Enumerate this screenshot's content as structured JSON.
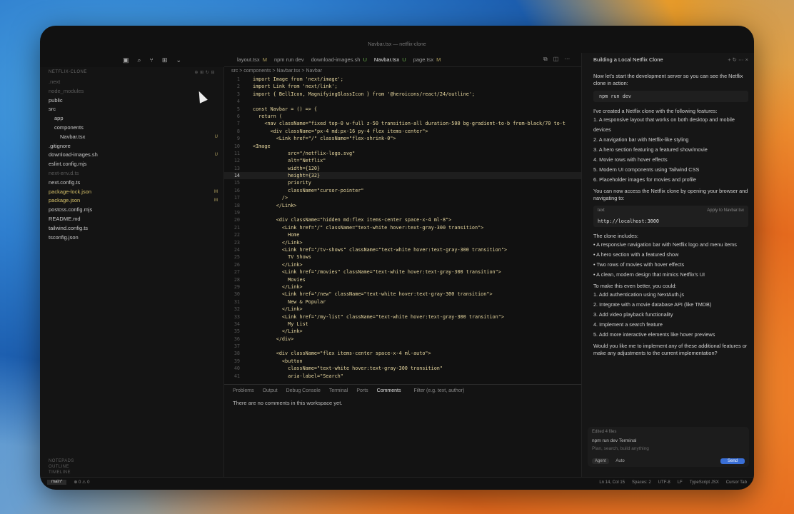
{
  "window": {
    "title": "Navbar.tsx — netflix-clone"
  },
  "explorer": {
    "header": "NETFLIX-CLONE",
    "items": [
      {
        "label": ".next",
        "style": "dim",
        "badge": ""
      },
      {
        "label": "node_modules",
        "style": "dim",
        "badge": ""
      },
      {
        "label": "public",
        "style": "",
        "badge": ""
      },
      {
        "label": "src",
        "style": "",
        "badge": ""
      },
      {
        "label": "app",
        "style": "",
        "badge": ""
      },
      {
        "label": "components",
        "style": "",
        "badge": ""
      },
      {
        "label": "Navbar.tsx",
        "style": "",
        "badge": "U"
      },
      {
        "label": ".gitignore",
        "style": "",
        "badge": ""
      },
      {
        "label": "download-images.sh",
        "style": "",
        "badge": "U"
      },
      {
        "label": "eslint.config.mjs",
        "style": "",
        "badge": ""
      },
      {
        "label": "next-env.d.ts",
        "style": "dim",
        "badge": ""
      },
      {
        "label": "next.config.ts",
        "style": "",
        "badge": ""
      },
      {
        "label": "package-lock.json",
        "style": "yellow",
        "badge": "M"
      },
      {
        "label": "package.json",
        "style": "yellow",
        "badge": "M"
      },
      {
        "label": "postcss.config.mjs",
        "style": "",
        "badge": ""
      },
      {
        "label": "README.md",
        "style": "",
        "badge": ""
      },
      {
        "label": "tailwind.config.ts",
        "style": "",
        "badge": ""
      },
      {
        "label": "tsconfig.json",
        "style": "",
        "badge": ""
      }
    ],
    "footer": [
      "NOTEPADS",
      "OUTLINE",
      "TIMELINE"
    ]
  },
  "tabs": [
    {
      "label": "layout.tsx",
      "badge": "M",
      "active": false
    },
    {
      "label": "npm run dev",
      "badge": "",
      "active": false
    },
    {
      "label": "download-images.sh",
      "badge": "U",
      "active": false
    },
    {
      "label": "Navbar.tsx",
      "badge": "U",
      "active": true
    },
    {
      "label": "page.tsx",
      "badge": "M",
      "active": false
    }
  ],
  "breadcrumb": "src > components > Navbar.tsx > Navbar",
  "code": [
    {
      "n": "1",
      "t": "import Image from 'next/image';"
    },
    {
      "n": "2",
      "t": "import Link from 'next/link';"
    },
    {
      "n": "3",
      "t": "import { BellIcon, MagnifyingGlassIcon } from '@heroicons/react/24/outline';"
    },
    {
      "n": "4",
      "t": ""
    },
    {
      "n": "5",
      "t": "const Navbar = () => {"
    },
    {
      "n": "6",
      "t": "  return ("
    },
    {
      "n": "7",
      "t": "    <nav className=\"fixed top-0 w-full z-50 transition-all duration-500 bg-gradient-to-b from-black/70 to-t"
    },
    {
      "n": "8",
      "t": "      <div className=\"px-4 md:px-16 py-4 flex items-center\">"
    },
    {
      "n": "9",
      "t": "        <Link href=\"/\" className=\"flex-shrink-0\">"
    },
    {
      "n": "10",
      "t": "<Image"
    },
    {
      "n": "11",
      "t": "            src=\"/netflix-logo.svg\""
    },
    {
      "n": "12",
      "t": "            alt=\"Netflix\""
    },
    {
      "n": "13",
      "t": "            width={120}"
    },
    {
      "n": "14",
      "t": "            height={32}"
    },
    {
      "n": "15",
      "t": "            priority"
    },
    {
      "n": "16",
      "t": "            className=\"cursor-pointer\""
    },
    {
      "n": "17",
      "t": "          />"
    },
    {
      "n": "18",
      "t": "        </Link>"
    },
    {
      "n": "19",
      "t": ""
    },
    {
      "n": "20",
      "t": "        <div className=\"hidden md:flex items-center space-x-4 ml-8\">"
    },
    {
      "n": "21",
      "t": "          <Link href=\"/\" className=\"text-white hover:text-gray-300 transition\">"
    },
    {
      "n": "22",
      "t": "            Home"
    },
    {
      "n": "23",
      "t": "          </Link>"
    },
    {
      "n": "24",
      "t": "          <Link href=\"/tv-shows\" className=\"text-white hover:text-gray-300 transition\">"
    },
    {
      "n": "25",
      "t": "            TV Shows"
    },
    {
      "n": "26",
      "t": "          </Link>"
    },
    {
      "n": "27",
      "t": "          <Link href=\"/movies\" className=\"text-white hover:text-gray-300 transition\">"
    },
    {
      "n": "28",
      "t": "            Movies"
    },
    {
      "n": "29",
      "t": "          </Link>"
    },
    {
      "n": "30",
      "t": "          <Link href=\"/new\" className=\"text-white hover:text-gray-300 transition\">"
    },
    {
      "n": "31",
      "t": "            New & Popular"
    },
    {
      "n": "32",
      "t": "          </Link>"
    },
    {
      "n": "33",
      "t": "          <Link href=\"/my-list\" className=\"text-white hover:text-gray-300 transition\">"
    },
    {
      "n": "34",
      "t": "            My List"
    },
    {
      "n": "35",
      "t": "          </Link>"
    },
    {
      "n": "36",
      "t": "        </div>"
    },
    {
      "n": "37",
      "t": ""
    },
    {
      "n": "38",
      "t": "        <div className=\"flex items-center space-x-4 ml-auto\">"
    },
    {
      "n": "39",
      "t": "          <button"
    },
    {
      "n": "40",
      "t": "            className=\"text-white hover:text-gray-300 transition\""
    },
    {
      "n": "41",
      "t": "            aria-label=\"Search\""
    }
  ],
  "current_line": "14",
  "panel": {
    "tabs": [
      "Problems",
      "Output",
      "Debug Console",
      "Terminal",
      "Ports",
      "Comments"
    ],
    "active": "Comments",
    "filter": "Filter (e.g. text, author)",
    "message": "There are no comments in this workspace yet."
  },
  "chat": {
    "title": "Building a Local Netflix Clone",
    "intro": "Now let's start the development server so you can see the Netflix clone in action:",
    "cmd": "npm run dev",
    "features_intro": "I've created a Netflix clone with the following features:",
    "features": [
      "1. A responsive layout that works on both desktop and mobile devices",
      "2. A navigation bar with Netflix-like styling",
      "3. A hero section featuring a featured show/movie",
      "4. Movie rows with hover effects",
      "5. Modern UI components using Tailwind CSS",
      "6. Placeholder images for movies and profile"
    ],
    "access": "You can now access the Netflix clone by opening your browser and navigating to:",
    "code_lang": "text",
    "code_apply": "Apply to Navbar.tsx",
    "url": "http://localhost:3000",
    "includes_intro": "The clone includes:",
    "includes": [
      "• A responsive navigation bar with Netflix logo and menu items",
      "• A hero section with a featured show",
      "• Two rows of movies with hover effects",
      "• A clean, modern design that mimics Netflix's UI"
    ],
    "better_intro": "To make this even better, you could:",
    "better": [
      "1. Add authentication using NextAuth.js",
      "2. Integrate with a movie database API (like TMDB)",
      "3. Add video playback functionality",
      "4. Implement a search feature",
      "5. Add more interactive elements like hover previews"
    ],
    "question": "Would you like me to implement any of these additional features or make any adjustments to the current implementation?",
    "edited": "Edited 4 files",
    "terminal": "npm run dev Terminal",
    "placeholder": "Plan, search, build anything",
    "mode": "Agent",
    "model": "Auto",
    "send": "Send"
  },
  "status": {
    "branch": "main*",
    "problems": "⊗ 0 ⚠ 0",
    "position": "Ln 14, Col 15",
    "spaces": "Spaces: 2",
    "encoding": "UTF-8",
    "eol": "LF",
    "lang": "TypeScript JSX",
    "tab": "Cursor Tab"
  }
}
